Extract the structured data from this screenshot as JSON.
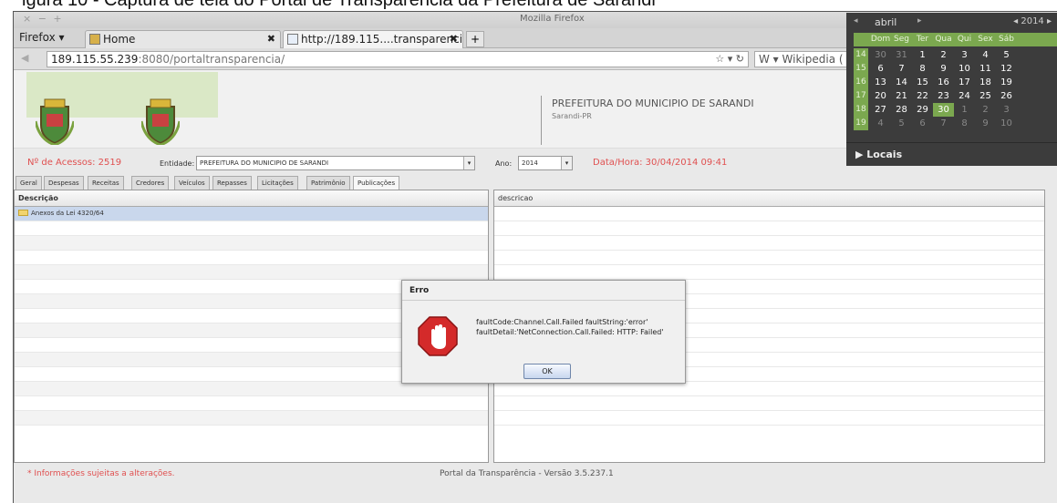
{
  "doc_header_fragment": "igura 10 - Captura de tela do Portal de Transparência da Prefeitura de Sarandi",
  "browser": {
    "window_controls": "× − +",
    "window_title": "Mozilla Firefox",
    "menu_label": "Firefox ▾",
    "tabs": [
      {
        "label": "Home",
        "close": "✖"
      },
      {
        "label": "http://189.115....transparencia/",
        "close": "✖"
      }
    ],
    "new_tab": "+",
    "url_host": "189.115.55.239",
    "url_rest": ":8080/portaltransparencia/",
    "url_tail": "☆ ▾ ↻",
    "search_text": "W ▾ Wikipedia (",
    "back": "◀"
  },
  "portal": {
    "prefeitura_name": "PREFEITURA DO MUNICIPIO DE SARANDI",
    "prefeitura_city": "Sarandi-PR",
    "acessos": "Nº de Acessos: 2519",
    "entidade_label": "Entidade:",
    "entidade_value": "PREFEITURA DO MUNICIPIO DE SARANDI",
    "ano_label": "Ano:",
    "ano_value": "2014",
    "datahora": "Data/Hora: 30/04/2014 09:41",
    "tabs": [
      "Geral",
      "Despesas",
      "Receitas",
      "Credores",
      "Veículos",
      "Repasses",
      "Licitações",
      "Patrimônio",
      "Publicações"
    ],
    "left_header": "Descrição",
    "right_header": "descricao",
    "rows": [
      "Anexos da Lei 4320/64"
    ],
    "footer_note": "* Informações sujeitas a alterações.",
    "footer_version": "Portal da Transparência - Versão 3.5.237.1"
  },
  "dialog": {
    "title": "Erro",
    "message": "faultCode:Channel.Call.Failed faultString:'error' faultDetail:'NetConnection.Call.Failed: HTTP: Failed'",
    "ok": "OK"
  },
  "calendar": {
    "month": "abril",
    "year": "◂ 2014 ▸",
    "nav_prev": "◂",
    "nav_next": "▸",
    "day_names": [
      "Dom",
      "Seg",
      "Ter",
      "Qua",
      "Qui",
      "Sex",
      "Sáb"
    ],
    "weeks": [
      {
        "wk": "14",
        "days": [
          "30",
          "31",
          "1",
          "2",
          "3",
          "4",
          "5"
        ]
      },
      {
        "wk": "15",
        "days": [
          "6",
          "7",
          "8",
          "9",
          "10",
          "11",
          "12"
        ]
      },
      {
        "wk": "16",
        "days": [
          "13",
          "14",
          "15",
          "16",
          "17",
          "18",
          "19"
        ]
      },
      {
        "wk": "17",
        "days": [
          "20",
          "21",
          "22",
          "23",
          "24",
          "25",
          "26"
        ]
      },
      {
        "wk": "18",
        "days": [
          "27",
          "28",
          "29",
          "30",
          "1",
          "2",
          "3"
        ]
      },
      {
        "wk": "19",
        "days": [
          "4",
          "5",
          "6",
          "7",
          "8",
          "9",
          "10"
        ]
      }
    ],
    "today": "30",
    "locais": "▶ Locais"
  }
}
